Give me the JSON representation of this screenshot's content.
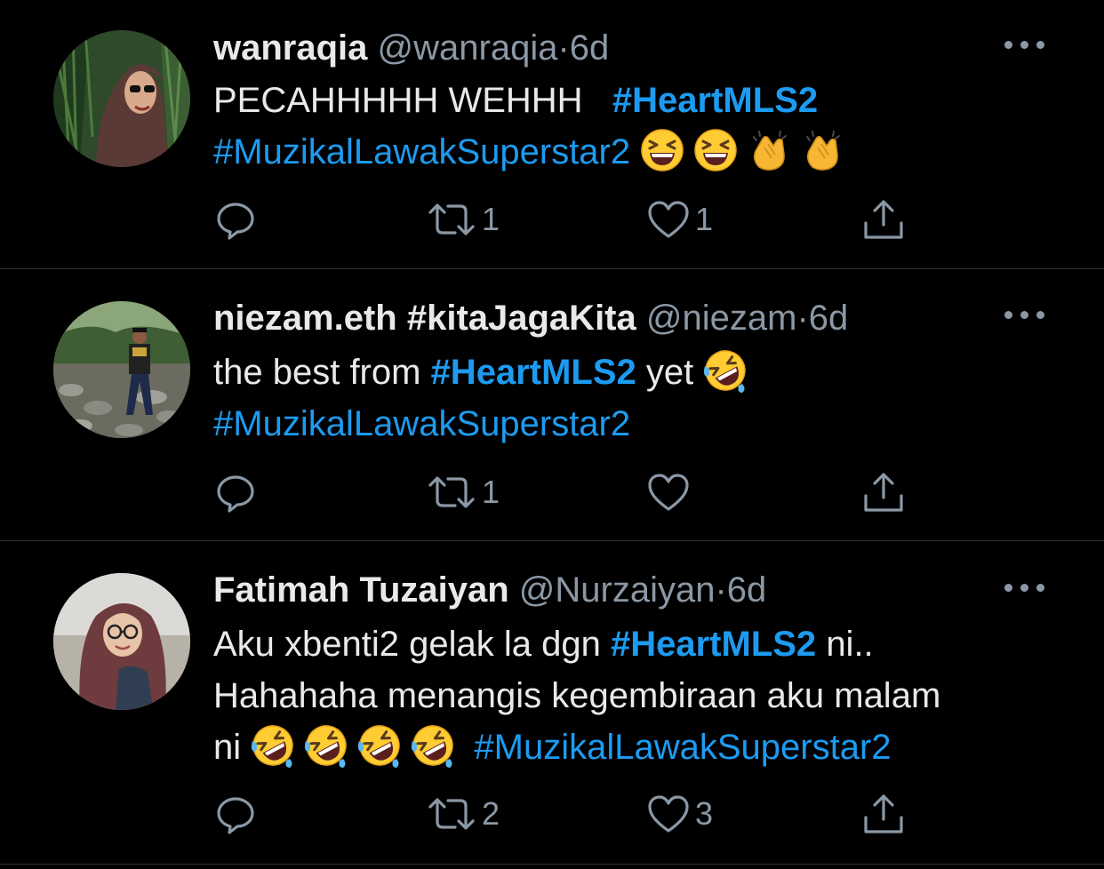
{
  "tweets": [
    {
      "name": "wanraqia",
      "handle": "@wanraqia",
      "separator": "·",
      "time": "6d",
      "text_1": "PECAHHHHH WEHHH",
      "tag_1": "#HeartMLS2",
      "tag_2": "#MuzikalLawakSuperstar2",
      "emojis": [
        "grinning-squinting-face",
        "grinning-squinting-face",
        "clapping-hands",
        "clapping-hands"
      ],
      "retweet_count": "1",
      "like_count": "1"
    },
    {
      "name": "niezam.eth #kitaJagaKita",
      "handle": "@niezam",
      "separator": "·",
      "time": "6d",
      "text_1": "the best from",
      "tag_1": "#HeartMLS2",
      "text_2": "yet",
      "tag_2": "#MuzikalLawakSuperstar2",
      "emojis": [
        "rolling-on-floor-laughing"
      ],
      "retweet_count": "1",
      "like_count": ""
    },
    {
      "name": "Fatimah Tuzaiyan",
      "handle": "@Nurzaiyan",
      "separator": "·",
      "time": "6d",
      "text_1": "Aku xbenti2 gelak la dgn",
      "tag_1": "#HeartMLS2",
      "text_2": "ni..",
      "text_3": "Hahahaha menangis kegembiraan aku malam",
      "text_4": "ni",
      "tag_2": "#MuzikalLawakSuperstar2",
      "emojis": [
        "rolling-on-floor-laughing",
        "rolling-on-floor-laughing",
        "rolling-on-floor-laughing",
        "rolling-on-floor-laughing"
      ],
      "retweet_count": "2",
      "like_count": "3"
    }
  ],
  "icons": {
    "reply": "reply-icon",
    "retweet": "retweet-icon",
    "like": "heart-icon",
    "share": "share-icon",
    "more": "more-icon"
  },
  "colors": {
    "background": "#000000",
    "text": "#e7e9ea",
    "secondary": "#8b98a5",
    "link": "#1d9bf0",
    "divider": "#2f3336"
  }
}
